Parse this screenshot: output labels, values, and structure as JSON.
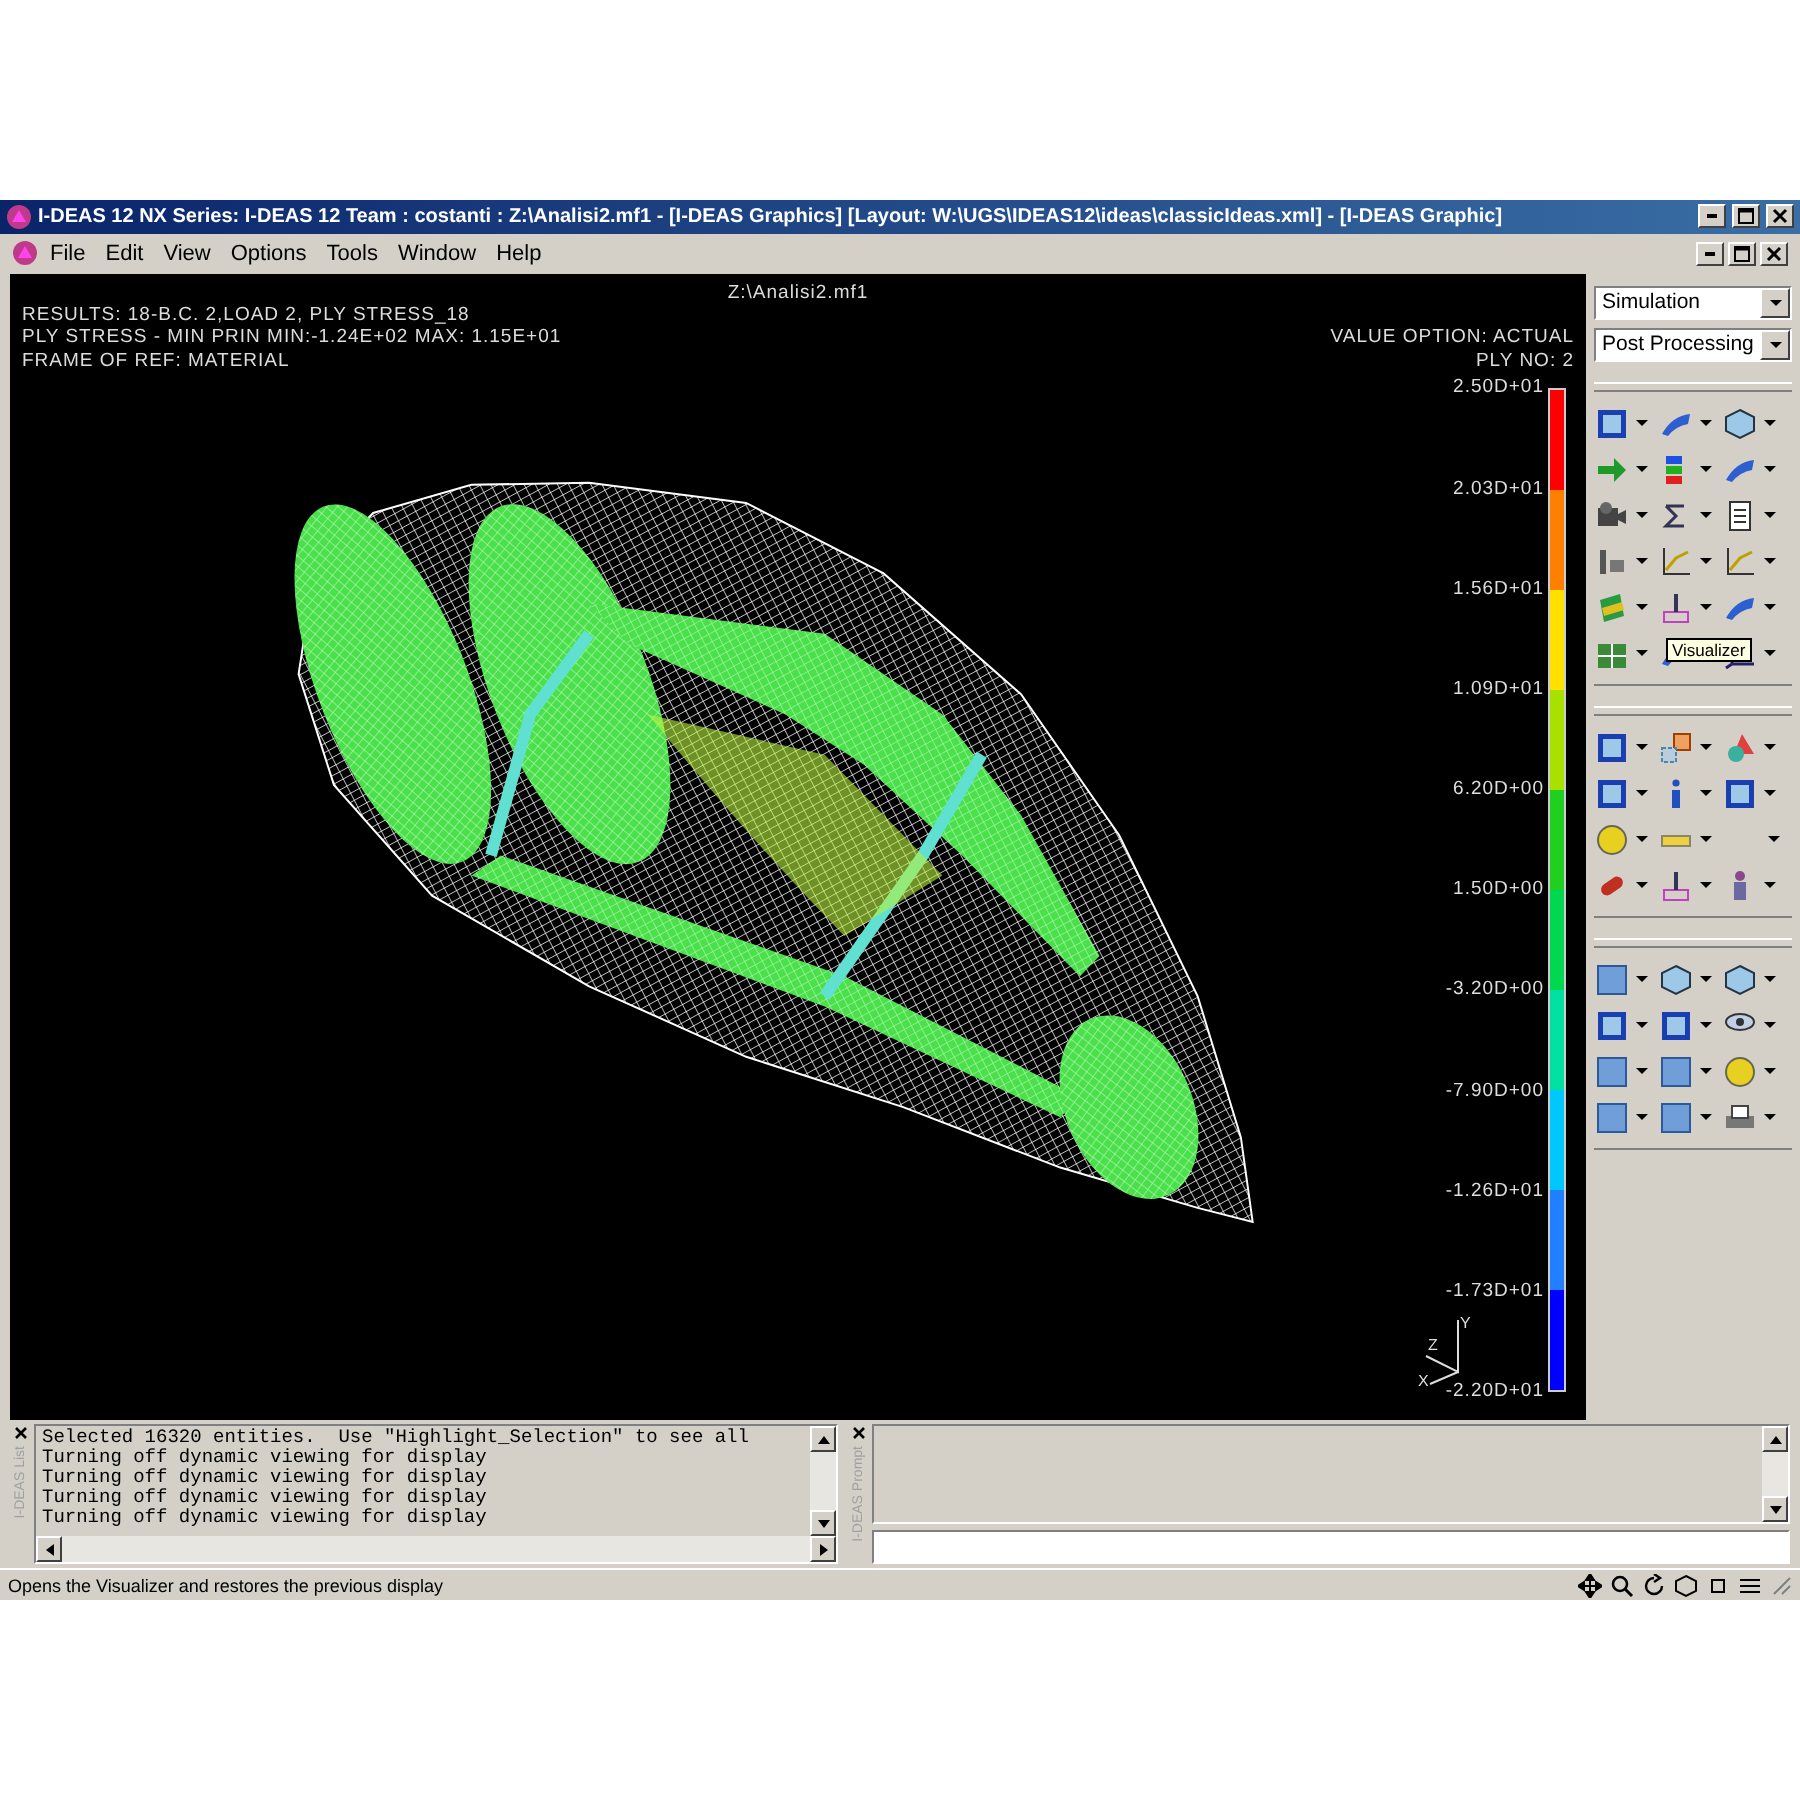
{
  "window": {
    "title": "I-DEAS 12 NX Series:   I-DEAS 12 Team : costanti : Z:\\Analisi2.mf1 - [I-DEAS Graphics]   [Layout: W:\\UGS\\IDEAS12\\ideas\\classicIdeas.xml]   - [I-DEAS Graphic]"
  },
  "menu": [
    "File",
    "Edit",
    "View",
    "Options",
    "Tools",
    "Window",
    "Help"
  ],
  "graphics": {
    "file": "Z:\\Analisi2.mf1",
    "info_left": [
      "RESULTS: 18-B.C. 2,LOAD 2, PLY STRESS_18",
      "PLY STRESS - MIN PRIN MIN:-1.24E+02 MAX: 1.15E+01",
      "FRAME OF REF: MATERIAL"
    ],
    "info_right": [
      "VALUE OPTION: ACTUAL",
      "PLY NO: 2"
    ],
    "legend": {
      "labels": [
        "2.50D+01",
        "2.03D+01",
        "1.56D+01",
        "1.09D+01",
        "6.20D+00",
        "1.50D+00",
        "-3.20D+00",
        "-7.90D+00",
        "-1.26D+01",
        "-1.73D+01",
        "-2.20D+01"
      ],
      "bands": [
        {
          "color": "#ff0000"
        },
        {
          "color": "#ff7f00"
        },
        {
          "color": "#ffe000"
        },
        {
          "color": "#a8e000"
        },
        {
          "color": "#20d020"
        },
        {
          "color": "#00d850"
        },
        {
          "color": "#00e0a0"
        },
        {
          "color": "#00c8ff"
        },
        {
          "color": "#2080ff"
        },
        {
          "color": "#0000ff"
        }
      ]
    },
    "triad": [
      "Y",
      "Z",
      "X"
    ]
  },
  "panel": {
    "dropdowns": [
      "Simulation",
      "Post Processing"
    ],
    "tooltip": "Visualizer"
  },
  "list": {
    "title": "I-DEAS List",
    "lines": [
      "Selected 16320 entities.  Use \"Highlight_Selection\" to see all",
      "Turning off dynamic viewing for display",
      "Turning off dynamic viewing for display",
      "Turning off dynamic viewing for display",
      "Turning off dynamic viewing for display"
    ]
  },
  "prompt": {
    "title": "I-DEAS Prompt"
  },
  "status_bar": "Opens the Visualizer and restores the previous display"
}
